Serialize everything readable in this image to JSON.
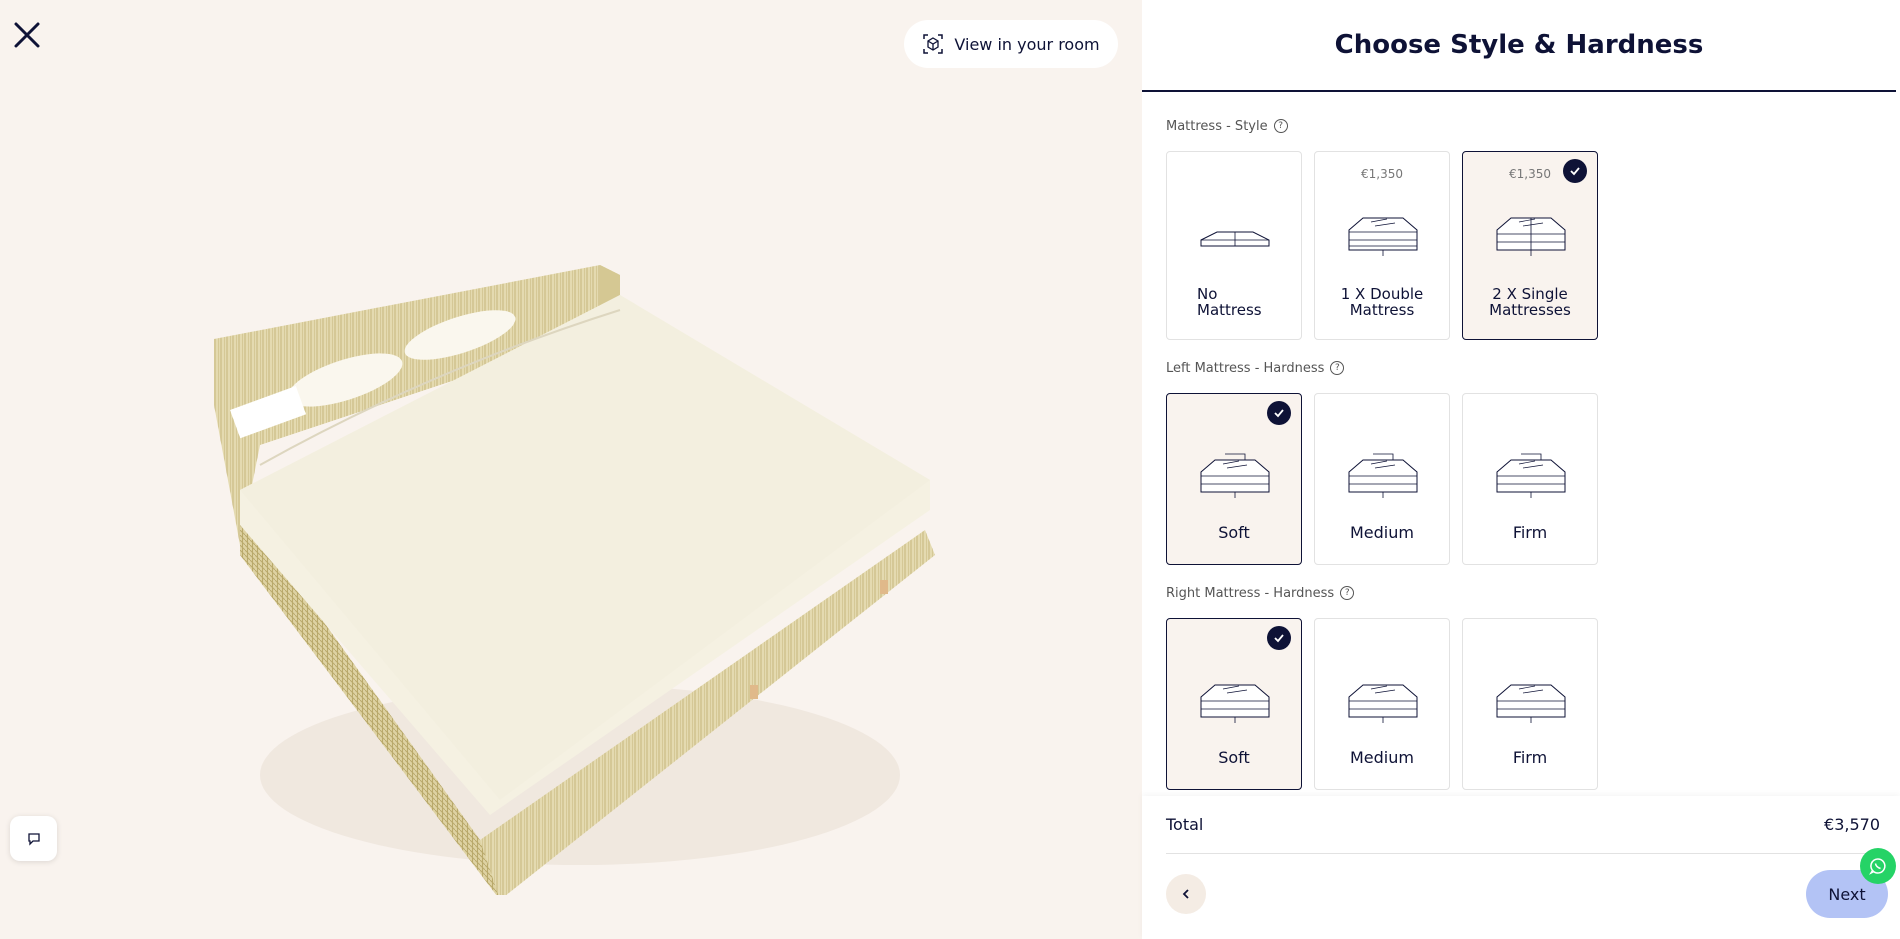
{
  "viewer": {
    "view_in_room_label": "View in your room"
  },
  "panel": {
    "title": "Choose Style & Hardness",
    "sections": [
      {
        "label": "Mattress - Style",
        "options": [
          {
            "price": "",
            "name_line1": "No",
            "name_line2": "Mattress",
            "selected": false
          },
          {
            "price": "€1,350",
            "name_line1": "1 X Double",
            "name_line2": "Mattress",
            "selected": false
          },
          {
            "price": "€1,350",
            "name_line1": "2 X Single",
            "name_line2": "Mattresses",
            "selected": true
          }
        ]
      },
      {
        "label": "Left Mattress - Hardness",
        "options": [
          {
            "name": "Soft",
            "selected": true
          },
          {
            "name": "Medium",
            "selected": false
          },
          {
            "name": "Firm",
            "selected": false
          }
        ]
      },
      {
        "label": "Right Mattress - Hardness",
        "options": [
          {
            "name": "Soft",
            "selected": true
          },
          {
            "name": "Medium",
            "selected": false
          },
          {
            "name": "Firm",
            "selected": false
          }
        ]
      }
    ]
  },
  "footer": {
    "total_label": "Total",
    "total_value": "€3,570",
    "next_label": "Next"
  },
  "icons": {
    "close": "close-icon",
    "view_room": "ar-cube-icon",
    "chat": "chat-icon",
    "help": "help-circle-icon",
    "check": "check-icon",
    "back": "chevron-left-icon",
    "whatsapp": "whatsapp-icon"
  },
  "colors": {
    "accent": "#0e1236",
    "background": "#f9f3ee",
    "next_button": "#b3c3f5",
    "whatsapp": "#25d366"
  }
}
